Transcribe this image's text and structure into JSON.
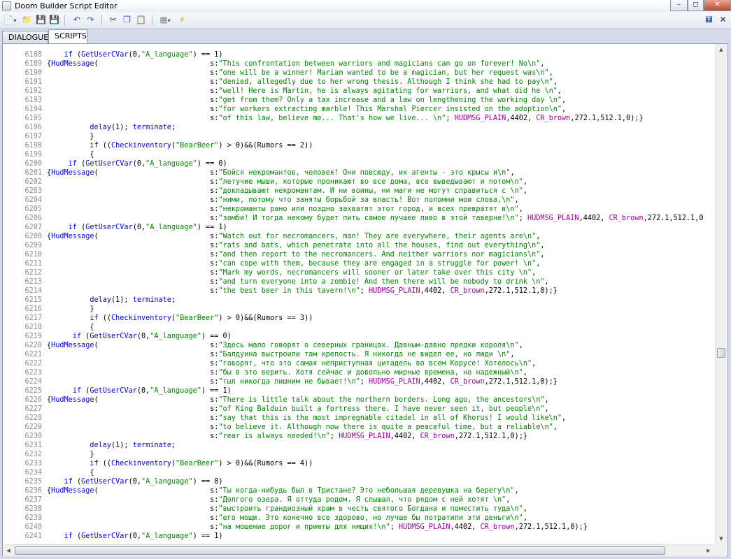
{
  "window": {
    "title": "Doom Builder Script Editor"
  },
  "tabs": [
    {
      "label": "DIALOGUE"
    },
    {
      "label": "SCRIPTS"
    }
  ],
  "icons": {
    "new": "new-file-icon",
    "open": "open-folder-icon",
    "save": "save-icon",
    "save_all": "save-all-icon",
    "undo": "undo-icon",
    "redo": "redo-icon",
    "cut": "cut-icon",
    "copy": "copy-icon",
    "paste": "paste-icon",
    "script": "script-icon",
    "compile": "compile-icon",
    "dock": "dock-icon",
    "close": "close-icon"
  },
  "colors": {
    "keyword": "#0000ff",
    "string": "#008800",
    "constant": "#a000a0",
    "line_number": "#8c8c8c"
  },
  "code_lines": [
    {
      "n": "6188",
      "c": "    if (GetUserCVar(0,\"A_language\") == 1)"
    },
    {
      "n": "6189",
      "c": "{HudMessage(                          s:\"This confrontation between warriors and magicians can go on forever! No\\n\","
    },
    {
      "n": "6190",
      "c": "                                      s:\"one will be a winner! Mariam wanted to be a magician, but her request was\\n\","
    },
    {
      "n": "6191",
      "c": "                                      s:\"denied, allegedly due to her wrong thesis. Although I think she had to pay\\n\","
    },
    {
      "n": "6192",
      "c": "                                      s:\"well! Here is Martin, he is always agitating for warriors, and what did he \\n\","
    },
    {
      "n": "6193",
      "c": "                                      s:\"get from them? Only a tax increase and a law on lengthening the working day \\n\","
    },
    {
      "n": "6194",
      "c": "                                      s:\"for workers extracting marble! This Marshal Piercer insisted on the adoption\\n\","
    },
    {
      "n": "6195",
      "c": "                                      s:\"of this law, believe me... That's how we live... \\n\"; HUDMSG_PLAIN,4402, CR_brown,272.1,512.1,0);}"
    },
    {
      "n": "6196",
      "c": "          delay(1); terminate;"
    },
    {
      "n": "6197",
      "c": "          }"
    },
    {
      "n": "6198",
      "c": "          if ((Checkinventory(\"BearBeer\") > 0)&&(Rumors == 2))"
    },
    {
      "n": "6199",
      "c": "          {"
    },
    {
      "n": "6200",
      "c": "     if (GetUserCVar(0,\"A_language\") == 0)"
    },
    {
      "n": "6201",
      "c": "{HudMessage(                          s:\"Бойся некромантов, человек! Они повсюду, их агенты - это крысы и\\n\","
    },
    {
      "n": "6202",
      "c": "                                      s:\"летучие мыши, которые проникают во все дома, все выведывают и потом\\n\","
    },
    {
      "n": "6203",
      "c": "                                      s:\"докладывают некромантам. И ни воины, ни маги не могут справиться с \\n\","
    },
    {
      "n": "6204",
      "c": "                                      s:\"ними, потому что заняты борьбой за власть! Вот попомни мои слова,\\n\","
    },
    {
      "n": "6205",
      "c": "                                      s:\"некроманты рано или поздно захватят этот город, и всех превратят в\\n\","
    },
    {
      "n": "6206",
      "c": "                                      s:\"зомби! И тогда некому будет пить самое лучшее пиво в этой таверне!\\n\"; HUDMSG_PLAIN,4402, CR_brown,272.1,512.1,0"
    },
    {
      "n": "6207",
      "c": "     if (GetUserCVar(0,\"A_language\") == 1)"
    },
    {
      "n": "6208",
      "c": "{HudMessage(                          s:\"Watch out for necromancers, man! They are everywhere, their agents are\\n\","
    },
    {
      "n": "6209",
      "c": "                                      s:\"rats and bats, which penetrate into all the houses, find out everything\\n\","
    },
    {
      "n": "6210",
      "c": "                                      s:\"and then report to the necromancers. And neither warriors nor magicians\\n\","
    },
    {
      "n": "6211",
      "c": "                                      s:\"can cope with them, because they are engaged in a struggle for power! \\n\","
    },
    {
      "n": "6212",
      "c": "                                      s:\"Mark my words, necromancers will sooner or later take over this city \\n\","
    },
    {
      "n": "6213",
      "c": "                                      s:\"and turn everyone into a zombie! And then there will be nobody to drink \\n\","
    },
    {
      "n": "6214",
      "c": "                                      s:\"the best beer in this tavern!\\n\"; HUDMSG_PLAIN,4402, CR_brown,272.1,512.1,0);}"
    },
    {
      "n": "6215",
      "c": "          delay(1); terminate;"
    },
    {
      "n": "6216",
      "c": "          }"
    },
    {
      "n": "6217",
      "c": "          if ((Checkinventory(\"BearBeer\") > 0)&&(Rumors == 3))"
    },
    {
      "n": "6218",
      "c": "          {"
    },
    {
      "n": "6219",
      "c": "      if (GetUserCVar(0,\"A_language\") == 0)"
    },
    {
      "n": "6220",
      "c": "{HudMessage(                          s:\"Здесь мало говорят о северных границах. Давным-давно предки короля\\n\","
    },
    {
      "n": "6221",
      "c": "                                      s:\"Балдуина выстроили там крепость. Я никогда не видел ее, но люди \\n\","
    },
    {
      "n": "6222",
      "c": "                                      s:\"говорят, что это самая неприступная цитадель во всем Корусе! Хотелось\\n\","
    },
    {
      "n": "6223",
      "c": "                                      s:\"бы в это верить. Хотя сейчас и довольно мирные времена, но надежный\\n\","
    },
    {
      "n": "6224",
      "c": "                                      s:\"тыл никогда лишним не бывает!\\n\"; HUDMSG_PLAIN,4402, CR_brown,272.1,512.1,0);}"
    },
    {
      "n": "6225",
      "c": "      if (GetUserCVar(0,\"A_language\") == 1)"
    },
    {
      "n": "6226",
      "c": "{HudMessage(                          s:\"There is little talk about the northern borders. Long ago, the ancestors\\n\","
    },
    {
      "n": "6227",
      "c": "                                      s:\"of King Balduin built a fortress there. I have never seen it, but people\\n\","
    },
    {
      "n": "6228",
      "c": "                                      s:\"say that this is the most impregnable citadel in all of Khorus! I would like\\n\","
    },
    {
      "n": "6229",
      "c": "                                      s:\"to believe it. Although now there is quite a peaceful time, but a reliable\\n\","
    },
    {
      "n": "6230",
      "c": "                                      s:\"rear is always needed!\\n\"; HUDMSG_PLAIN,4402, CR_brown,272.1,512.1,0);}"
    },
    {
      "n": "6231",
      "c": "          delay(1); terminate;"
    },
    {
      "n": "6232",
      "c": "          }"
    },
    {
      "n": "6233",
      "c": "          if ((Checkinventory(\"BearBeer\") > 0)&&(Rumors == 4))"
    },
    {
      "n": "6234",
      "c": "          {"
    },
    {
      "n": "6235",
      "c": "    if (GetUserCVar(0,\"A_language\") == 0)"
    },
    {
      "n": "6236",
      "c": "{HudMessage(                          s:\"Ты когда-нибудь был в Тристане? Это небольшая деревушка на берегу\\n\","
    },
    {
      "n": "6237",
      "c": "                                      s:\"Долгого озера. Я оттуда родом. Я слышал, что рядом с ней хотят \\n\","
    },
    {
      "n": "6238",
      "c": "                                      s:\"выстроить грандиозный храм в честь святого Богдана и поместить туда\\n\","
    },
    {
      "n": "6239",
      "c": "                                      s:\"его мощи. Это конечно все здорово, но лучше бы потратили эти деньги\\n\","
    },
    {
      "n": "6240",
      "c": "                                      s:\"на мощение дорог и приюты для нищих!\\n\"; HUDMSG_PLAIN,4402, CR_brown,272.1,512.1,0);}"
    },
    {
      "n": "6241",
      "c": "    if (GetUserCVar(0,\"A_language\") == 1)"
    }
  ]
}
